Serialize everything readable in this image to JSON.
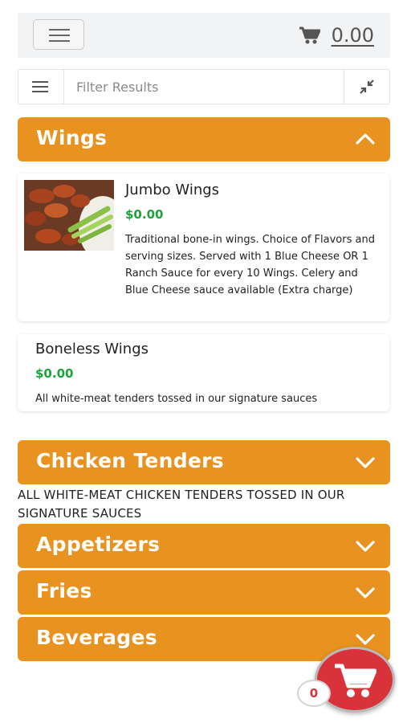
{
  "header": {
    "cart_total": "0.00",
    "menu_icon": "hamburger-icon",
    "cart_icon": "cart-icon"
  },
  "filter": {
    "placeholder": "Filter Results",
    "value": ""
  },
  "categories": [
    {
      "title": "Wings",
      "expanded": true,
      "items": [
        {
          "name": "Jumbo Wings",
          "price": "$0.00",
          "description": "Traditional bone-in wings. Choice of Flavors and serving sizes. Served with 1 Blue Cheese OR 1 Ranch Sauce for every 10 Wings. Celery and Blue Cheese sauce available (Extra charge)"
        },
        {
          "name": "Boneless Wings",
          "price": "$0.00",
          "description": "All white-meat tenders tossed in our signature sauces"
        }
      ]
    },
    {
      "title": "Chicken Tenders",
      "expanded": false,
      "note": "ALL WHITE-MEAT CHICKEN TENDERS TOSSED IN OUR SIGNATURE SAUCES"
    },
    {
      "title": "Appetizers",
      "expanded": false
    },
    {
      "title": "Fries",
      "expanded": false
    },
    {
      "title": "Beverages",
      "expanded": false
    }
  ],
  "floating_cart": {
    "count": "0"
  },
  "colors": {
    "category_bg": "#e8921f",
    "price": "#1ea23a",
    "fab": "#d9323b"
  }
}
